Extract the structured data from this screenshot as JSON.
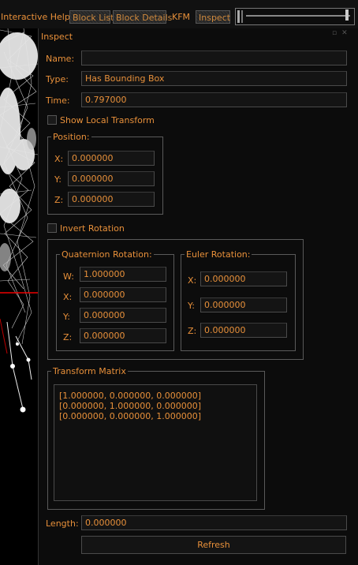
{
  "tabs": [
    {
      "label": "Interactive Help",
      "boxed": false
    },
    {
      "label": "Block List",
      "boxed": true
    },
    {
      "label": "Block Details",
      "boxed": true
    },
    {
      "label": "KFM",
      "boxed": false
    },
    {
      "label": "Inspect",
      "boxed": true
    }
  ],
  "panel": {
    "title": "Inspect",
    "name_label": "Name:",
    "name_value": "",
    "type_label": "Type:",
    "type_value": "Has Bounding Box",
    "time_label": "Time:",
    "time_value": "0.797000",
    "show_local_transform_label": "Show Local Transform",
    "show_local_transform_checked": false,
    "position": {
      "title": "Position:",
      "x_label": "X:",
      "x_value": "0.000000",
      "y_label": "Y:",
      "y_value": "0.000000",
      "z_label": "Z:",
      "z_value": "0.000000"
    },
    "invert_rotation_label": "Invert Rotation",
    "invert_rotation_checked": false,
    "quaternion": {
      "title": "Quaternion Rotation:",
      "w_label": "W:",
      "w_value": "1.000000",
      "x_label": "X:",
      "x_value": "0.000000",
      "y_label": "Y:",
      "y_value": "0.000000",
      "z_label": "Z:",
      "z_value": "0.000000"
    },
    "euler": {
      "title": "Euler Rotation:",
      "x_label": "X:",
      "x_value": "0.000000",
      "y_label": "Y:",
      "y_value": "0.000000",
      "z_label": "Z:",
      "z_value": "0.000000"
    },
    "matrix": {
      "title": "Transform Matrix",
      "rows": [
        "[1.000000, 0.000000, 0.000000]",
        "[0.000000, 1.000000, 0.000000]",
        "[0.000000, 0.000000, 1.000000]"
      ]
    },
    "length_label": "Length:",
    "length_value": "0.000000",
    "refresh_label": "Refresh"
  },
  "colors": {
    "text": "#e8903a",
    "background": "#0c0c0c",
    "field": "#141414",
    "border": "#4a4a4a"
  }
}
